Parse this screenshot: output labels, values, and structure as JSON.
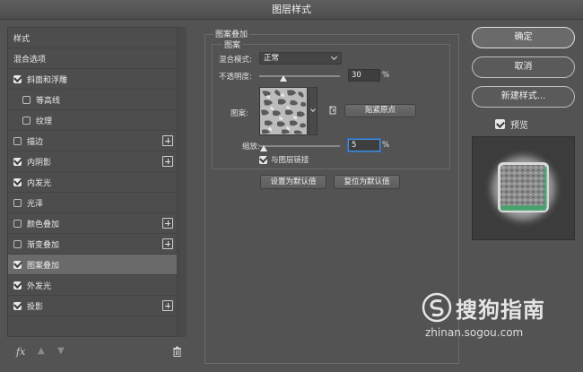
{
  "window": {
    "title": "图层样式"
  },
  "style_list": {
    "items": [
      {
        "label": "样式",
        "checkbox": false,
        "checked": false,
        "indent": 0,
        "plus": false,
        "selected": false
      },
      {
        "label": "混合选项",
        "checkbox": false,
        "checked": false,
        "indent": 0,
        "plus": false,
        "selected": false
      },
      {
        "label": "斜面和浮雕",
        "checkbox": true,
        "checked": true,
        "indent": 0,
        "plus": false,
        "selected": false
      },
      {
        "label": "等高线",
        "checkbox": true,
        "checked": false,
        "indent": 1,
        "plus": false,
        "selected": false
      },
      {
        "label": "纹理",
        "checkbox": true,
        "checked": false,
        "indent": 1,
        "plus": false,
        "selected": false
      },
      {
        "label": "描边",
        "checkbox": true,
        "checked": false,
        "indent": 0,
        "plus": true,
        "selected": false
      },
      {
        "label": "内阴影",
        "checkbox": true,
        "checked": true,
        "indent": 0,
        "plus": true,
        "selected": false
      },
      {
        "label": "内发光",
        "checkbox": true,
        "checked": true,
        "indent": 0,
        "plus": false,
        "selected": false
      },
      {
        "label": "光泽",
        "checkbox": true,
        "checked": false,
        "indent": 0,
        "plus": false,
        "selected": false
      },
      {
        "label": "颜色叠加",
        "checkbox": true,
        "checked": false,
        "indent": 0,
        "plus": true,
        "selected": false
      },
      {
        "label": "渐变叠加",
        "checkbox": true,
        "checked": false,
        "indent": 0,
        "plus": true,
        "selected": false
      },
      {
        "label": "图案叠加",
        "checkbox": true,
        "checked": true,
        "indent": 0,
        "plus": false,
        "selected": true
      },
      {
        "label": "外发光",
        "checkbox": true,
        "checked": true,
        "indent": 0,
        "plus": false,
        "selected": false
      },
      {
        "label": "投影",
        "checkbox": true,
        "checked": true,
        "indent": 0,
        "plus": true,
        "selected": false
      }
    ],
    "footer": {
      "fx_label": "fx"
    }
  },
  "pattern_overlay": {
    "section_title": "图案叠加",
    "group_title": "图案",
    "blend_mode_label": "混合模式:",
    "blend_mode_value": "正常",
    "opacity_label": "不透明度:",
    "opacity_value": "30",
    "opacity_unit": "%",
    "opacity_fraction": 0.3,
    "pattern_label": "图案:",
    "snap_button": "贴紧原点",
    "scale_label": "缩放:",
    "scale_value": "5",
    "scale_unit": "%",
    "scale_fraction": 0.05,
    "link_label": "与图层链接",
    "link_checked": true,
    "set_default_button": "设置为默认值",
    "reset_default_button": "复位为默认值"
  },
  "right_panel": {
    "ok_button": "确定",
    "cancel_button": "取消",
    "new_style_button": "新建样式...",
    "preview_label": "预览",
    "preview_checked": true
  },
  "watermark": {
    "brand_text": "搜狗指南",
    "url_text": "zhinan.sogou.com"
  },
  "colors": {
    "panel_bg": "#535353",
    "selected_row": "#6a6a6a",
    "focus_blue": "#4a8fd8",
    "preview_glow_green": "#3fa56a"
  }
}
